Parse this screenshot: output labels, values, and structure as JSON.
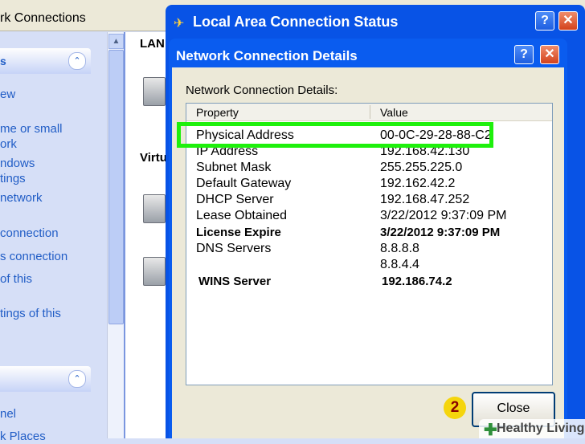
{
  "background_window": {
    "title": "rk Connections",
    "task_groups": [
      {
        "title": "s",
        "links": [
          "ew",
          "me or small",
          "ork",
          "ndows",
          "tings",
          "network",
          "connection",
          "s connection",
          "of this",
          "tings of this"
        ]
      },
      {
        "title": "",
        "links": [
          "nel",
          "k Places"
        ]
      }
    ],
    "sections": [
      "LAN",
      "Virtu"
    ]
  },
  "status_window": {
    "title": "Local Area Connection Status",
    "help_label": "?",
    "close_label": "✕"
  },
  "details_dialog": {
    "title": "Network Connection Details",
    "help_label": "?",
    "close_label": "✕",
    "label": "Network Connection Details:",
    "columns": {
      "property": "Property",
      "value": "Value"
    },
    "rows": [
      {
        "property": "Physical Address",
        "value": "00-0C-29-28-88-C2"
      },
      {
        "property": "IP Address",
        "value": "192.168.42.130"
      },
      {
        "property": "Subnet Mask",
        "value": "255.255.225.0"
      },
      {
        "property": "Default Gateway",
        "value": "192.162.42.2"
      },
      {
        "property": "DHCP Server",
        "value": "192.168.47.252"
      },
      {
        "property": "Lease Obtained",
        "value": "3/22/2012 9:37:09 PM"
      },
      {
        "property": "License Expire",
        "value": "3/22/2012 9:37:09 PM"
      },
      {
        "property": "DNS Servers",
        "value": "8.8.8.8"
      },
      {
        "property": "",
        "value": "8.8.4.4"
      },
      {
        "property": "WINS Server",
        "value": "192.186.74.2"
      }
    ],
    "close_button": "Close"
  },
  "annotation": {
    "step_number": "2",
    "highlight_color": "#1ef00c"
  },
  "watermark": {
    "plus": "✚",
    "text": "Healthy Living"
  }
}
